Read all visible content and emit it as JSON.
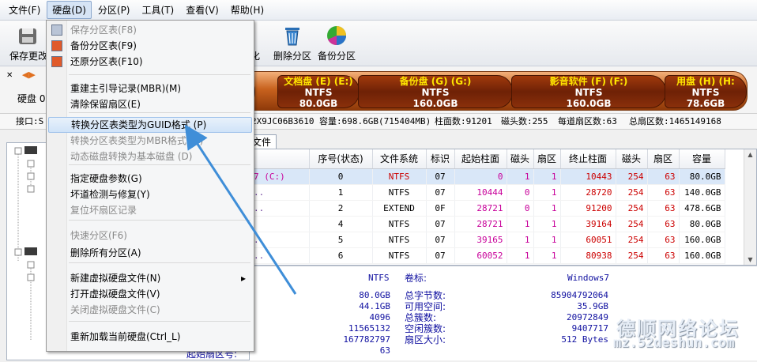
{
  "menubar": {
    "items": [
      "文件(F)",
      "硬盘(D)",
      "分区(P)",
      "工具(T)",
      "查看(V)",
      "帮助(H)"
    ]
  },
  "toolbar": {
    "save_label": "保存更改",
    "partial_label": "化",
    "delete_label": "删除分区",
    "backup_label": "备份分区"
  },
  "left": {
    "disk_label": "硬盘 0",
    "port_label": "接口:S"
  },
  "disk_map": [
    {
      "name": "文档盘 (E) (E:)",
      "fs": "NTFS",
      "size": "80.0GB"
    },
    {
      "name": "备份盘 (G) (G:)",
      "fs": "NTFS",
      "size": "160.0GB"
    },
    {
      "name": "影音软件 (F) (F:)",
      "fs": "NTFS",
      "size": "160.0GB"
    },
    {
      "name": "用盘 (H) (H:",
      "fs": "NTFS",
      "size": "78.6GB"
    }
  ],
  "infoline": {
    "serial": "2X9JC06B3610",
    "capacity": "容量:698.6GB(715404MB)",
    "cylinders": "柱面数:91201",
    "heads": "磁头数:255",
    "sectors": "每道扇区数:63",
    "total": "总扇区数:1465149168"
  },
  "tabs": {
    "files": "文件"
  },
  "table": {
    "headers": [
      "序号(状态)",
      "文件系统",
      "标识",
      "起始柱面",
      "磁头",
      "扇区",
      "终止柱面",
      "磁头",
      "扇区",
      "容量"
    ],
    "prefix": [
      "7 (C:)",
      "..",
      "..",
      "",
      "..",
      ".."
    ],
    "rows": [
      [
        "0",
        "NTFS",
        "07",
        "0",
        "1",
        "1",
        "10443",
        "254",
        "63",
        "80.0GB"
      ],
      [
        "1",
        "NTFS",
        "07",
        "10444",
        "0",
        "1",
        "28720",
        "254",
        "63",
        "140.0GB"
      ],
      [
        "2",
        "EXTEND",
        "0F",
        "28721",
        "0",
        "1",
        "91200",
        "254",
        "63",
        "478.6GB"
      ],
      [
        "4",
        "NTFS",
        "07",
        "28721",
        "1",
        "1",
        "39164",
        "254",
        "63",
        "80.0GB"
      ],
      [
        "5",
        "NTFS",
        "07",
        "39165",
        "1",
        "1",
        "60051",
        "254",
        "63",
        "160.0GB"
      ],
      [
        "6",
        "NTFS",
        "07",
        "60052",
        "1",
        "1",
        "80938",
        "254",
        "63",
        "160.0GB"
      ]
    ]
  },
  "detail": {
    "fs_value": "NTFS",
    "volume_label": "卷标:",
    "volume_value": "Windows7",
    "left_values": [
      "80.0GB",
      "44.1GB",
      "4096",
      "11565132",
      "167782797",
      "63"
    ],
    "right_labels": [
      "总字节数:",
      "可用空间:",
      "总簇数:",
      "空闲簇数:",
      "扇区大小:"
    ],
    "right_values": [
      "85904792064",
      "35.9GB",
      "20972849",
      "9407717",
      "512 Bytes"
    ],
    "cut_label": "起始扇区号:"
  },
  "menu": {
    "items": [
      {
        "label": "保存分区表(F8)",
        "disabled": true
      },
      {
        "label": "备份分区表(F9)",
        "disabled": false
      },
      {
        "label": "还原分区表(F10)",
        "disabled": false
      },
      {
        "label": "重建主引导记录(MBR)(M)",
        "disabled": false
      },
      {
        "label": "清除保留扇区(E)",
        "disabled": false
      },
      {
        "label": "转换分区表类型为GUID格式 (P)",
        "disabled": false
      },
      {
        "label": "转换分区表类型为MBR格式 (B)",
        "disabled": true
      },
      {
        "label": "动态磁盘转换为基本磁盘 (D)",
        "disabled": true
      },
      {
        "label": "指定硬盘参数(G)",
        "disabled": false
      },
      {
        "label": "坏道检测与修复(Y)",
        "disabled": false
      },
      {
        "label": "复位坏扇区记录",
        "disabled": true
      },
      {
        "label": "快速分区(F6)",
        "disabled": true
      },
      {
        "label": "删除所有分区(A)",
        "disabled": false
      },
      {
        "label": "新建虚拟硬盘文件(N)",
        "disabled": false
      },
      {
        "label": "打开虚拟硬盘文件(V)",
        "disabled": false
      },
      {
        "label": "关闭虚拟硬盘文件(C)",
        "disabled": true
      },
      {
        "label": "重新加载当前硬盘(Ctrl_L)",
        "disabled": false
      }
    ]
  },
  "watermark": {
    "line1": "德顺网络论坛",
    "line2": "mz.52deshun.com"
  },
  "colors": {
    "highlight": "#d0e3f8",
    "arrow": "#3f8ed8",
    "partition": "#7a2608",
    "label_yellow": "#ffe600"
  }
}
